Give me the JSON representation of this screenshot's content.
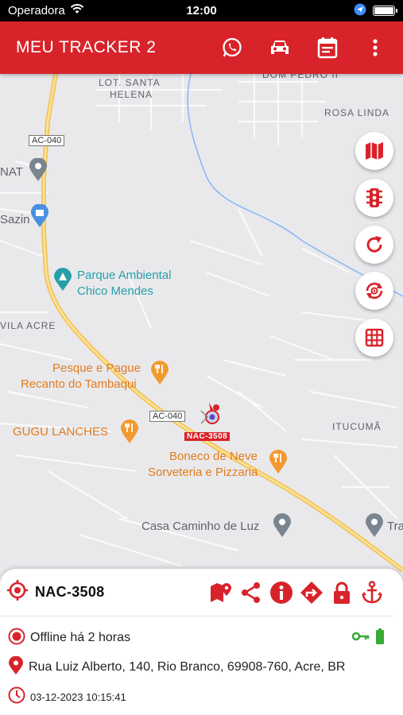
{
  "status": {
    "carrier": "Operadora",
    "time": "12:00"
  },
  "app": {
    "title": "MEU TRACKER 2"
  },
  "map": {
    "labels": [
      "LOT. SANTA",
      "HELENA",
      "DOM PEDRO II",
      "ROSA LINDA",
      "NAT",
      "Sazin",
      "VILA ACRE",
      "ITUCUMÃ"
    ],
    "roads": [
      "AC-040",
      "AC-040"
    ],
    "pois": {
      "parque_line1": "Parque Ambiental",
      "parque_line2": "Chico Mendes",
      "pesque_line1": "Pesque e Pague",
      "pesque_line2": "Recanto do Tambaqui",
      "gugu": "GUGU LANCHES",
      "boneco_line1": "Boneco de Neve",
      "boneco_line2": "Sorveteria e Pizzaria",
      "casa": "Casa Caminho de Luz",
      "tra": "Tra"
    },
    "vehicle_plate": "NAC-3508"
  },
  "panel": {
    "plate": "NAC-3508",
    "status": "Offline há 2 horas",
    "address": "Rua Luiz Alberto, 140, Rio Branco, 69908-760, Acre, BR",
    "datetime": "03-12-2023 10:15:41"
  },
  "colors": {
    "brand": "#d8232a",
    "ok": "#3aa935"
  }
}
